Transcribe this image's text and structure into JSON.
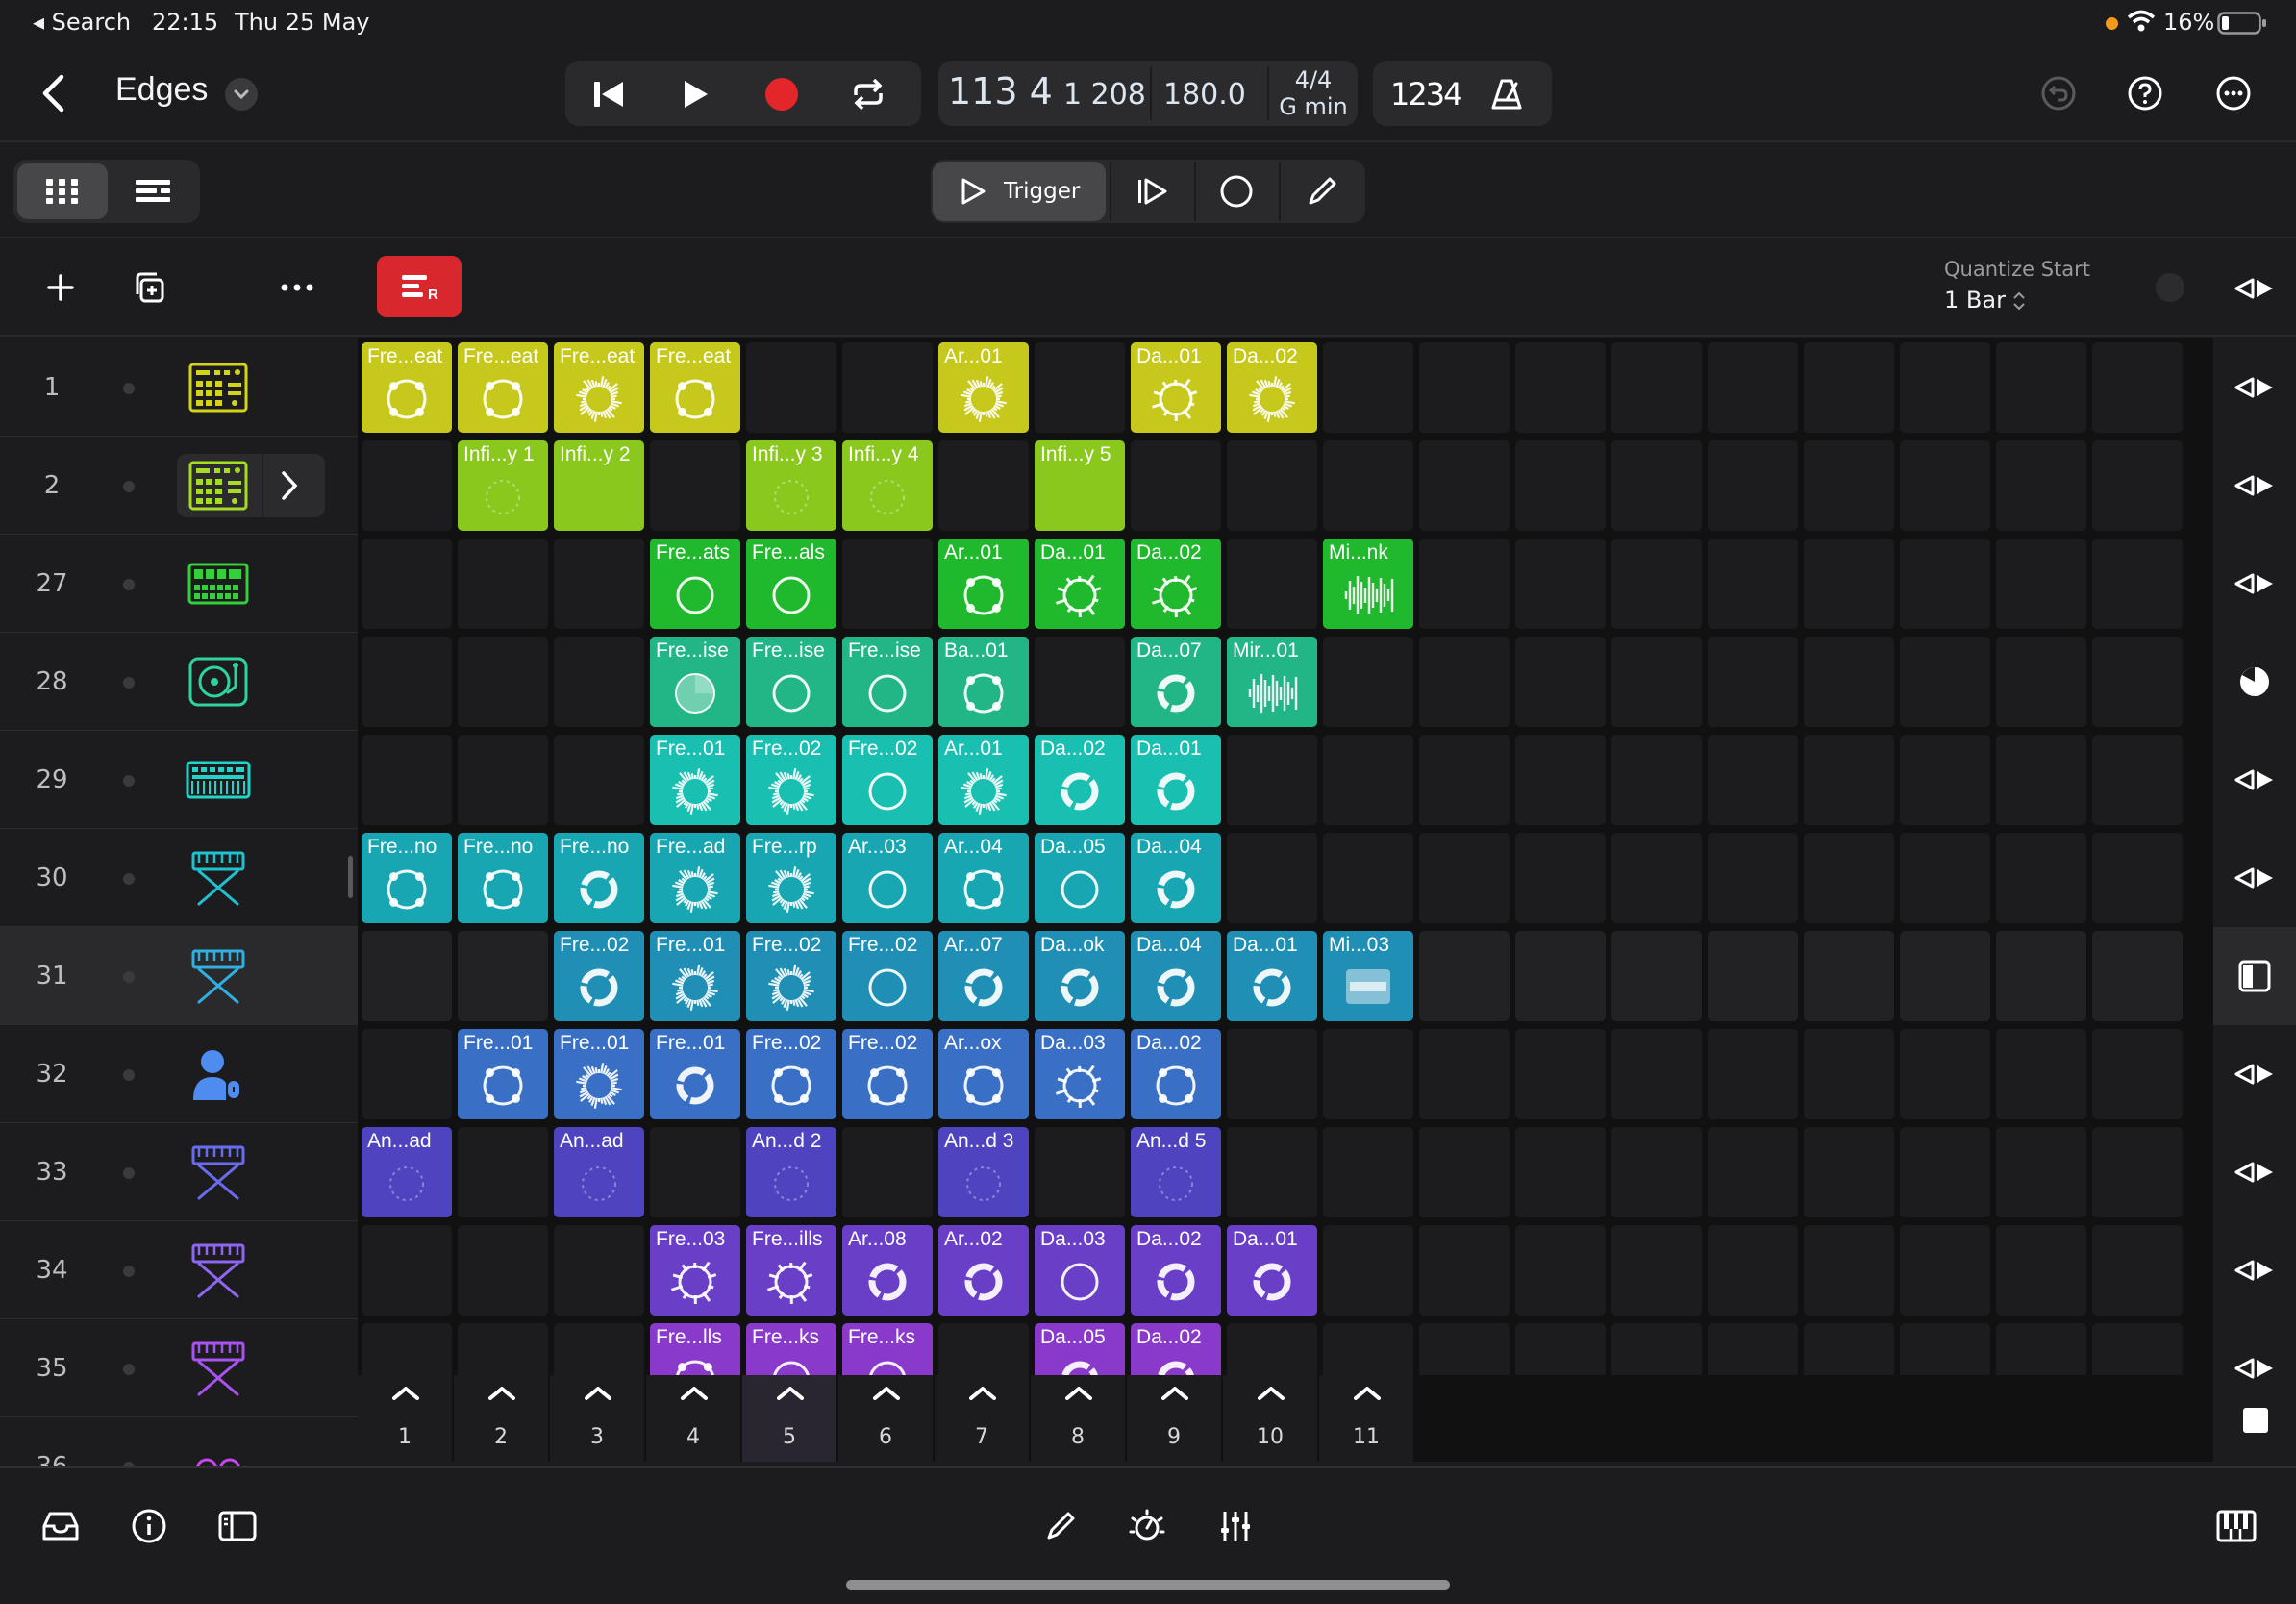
{
  "status_bar": {
    "back_app": "◂ Search",
    "time": "22:15",
    "date": "Thu 25 May",
    "battery": "16%"
  },
  "header": {
    "project_title": "Edges"
  },
  "transport": {
    "bar_beat": "113 4",
    "sub": "1 208",
    "tempo": "180.0",
    "time_signature": "4/4",
    "key": "G min",
    "count_in": "1234"
  },
  "modes": {
    "trigger_label": "Trigger"
  },
  "quantize": {
    "label": "Quantize Start",
    "value": "1 Bar"
  },
  "tracks": [
    {
      "num": "1",
      "icon": "drum-machine-icon",
      "color": "#d3d419"
    },
    {
      "num": "2",
      "icon": "drum-machine-icon",
      "color": "#a6dc24"
    },
    {
      "num": "27",
      "icon": "beat-sequencer-icon",
      "color": "#34d03a"
    },
    {
      "num": "28",
      "icon": "turntable-icon",
      "color": "#2ed3a0"
    },
    {
      "num": "29",
      "icon": "synth-icon",
      "color": "#22d4c8"
    },
    {
      "num": "30",
      "icon": "keyboard-stand-icon",
      "color": "#1fc1cf"
    },
    {
      "num": "31",
      "icon": "keyboard-stand-icon",
      "color": "#2fb0e0"
    },
    {
      "num": "32",
      "icon": "vocalist-icon",
      "color": "#4f8cf0"
    },
    {
      "num": "33",
      "icon": "keyboard-stand-icon",
      "color": "#6a6cf0"
    },
    {
      "num": "34",
      "icon": "keyboard-stand-icon",
      "color": "#8e66f2"
    },
    {
      "num": "35",
      "icon": "keyboard-stand-icon",
      "color": "#a853f0"
    },
    {
      "num": "36",
      "icon": "audio-interface-icon",
      "color": "#c446ee"
    }
  ],
  "clips": [
    [
      {
        "col": 0,
        "label": "Fre...eat",
        "color": "#c6c81c",
        "style": "dots"
      },
      {
        "col": 1,
        "label": "Fre...eat",
        "color": "#c6c81c",
        "style": "dots"
      },
      {
        "col": 2,
        "label": "Fre...eat",
        "color": "#c6c81c",
        "style": "burst"
      },
      {
        "col": 3,
        "label": "Fre...eat",
        "color": "#c6c81c",
        "style": "dots"
      },
      {
        "col": 6,
        "label": "Ar...01",
        "color": "#c6c81c",
        "style": "burst"
      },
      {
        "col": 8,
        "label": "Da...01",
        "color": "#c6c81c",
        "style": "spiky"
      },
      {
        "col": 9,
        "label": "Da...02",
        "color": "#c6c81c",
        "style": "burst"
      }
    ],
    [
      {
        "col": 1,
        "label": "Infi...y 1",
        "color": "#8bc81e",
        "style": "faint"
      },
      {
        "col": 2,
        "label": "Infi...y 2",
        "color": "#8bc81e",
        "style": "none"
      },
      {
        "col": 4,
        "label": "Infi...y 3",
        "color": "#8bc81e",
        "style": "faint"
      },
      {
        "col": 5,
        "label": "Infi...y 4",
        "color": "#8bc81e",
        "style": "faint"
      },
      {
        "col": 7,
        "label": "Infi...y 5",
        "color": "#8bc81e",
        "style": "none"
      }
    ],
    [
      {
        "col": 3,
        "label": "Fre...ats",
        "color": "#20b82c",
        "style": "thin"
      },
      {
        "col": 4,
        "label": "Fre...als",
        "color": "#20b82c",
        "style": "thin"
      },
      {
        "col": 6,
        "label": "Ar...01",
        "color": "#20b82c",
        "style": "dots"
      },
      {
        "col": 7,
        "label": "Da...01",
        "color": "#20b82c",
        "style": "spiky"
      },
      {
        "col": 8,
        "label": "Da...02",
        "color": "#20b82c",
        "style": "spiky"
      },
      {
        "col": 10,
        "label": "Mi...nk",
        "color": "#20b82c",
        "style": "wave"
      }
    ],
    [
      {
        "col": 3,
        "label": "Fre...ise",
        "color": "#22b585",
        "style": "pie"
      },
      {
        "col": 4,
        "label": "Fre...ise",
        "color": "#22b585",
        "style": "thin"
      },
      {
        "col": 5,
        "label": "Fre...ise",
        "color": "#22b585",
        "style": "thin"
      },
      {
        "col": 6,
        "label": "Ba...01",
        "color": "#22b585",
        "style": "dots"
      },
      {
        "col": 8,
        "label": "Da...07",
        "color": "#22b585",
        "style": "thick"
      },
      {
        "col": 9,
        "label": "Mir...01",
        "color": "#22b585",
        "style": "wave"
      }
    ],
    [
      {
        "col": 3,
        "label": "Fre...01",
        "color": "#19bfb0",
        "style": "burst"
      },
      {
        "col": 4,
        "label": "Fre...02",
        "color": "#19bfb0",
        "style": "burst"
      },
      {
        "col": 5,
        "label": "Fre...02",
        "color": "#19bfb0",
        "style": "thin"
      },
      {
        "col": 6,
        "label": "Ar...01",
        "color": "#19bfb0",
        "style": "burst"
      },
      {
        "col": 7,
        "label": "Da...02",
        "color": "#19bfb0",
        "style": "thick"
      },
      {
        "col": 8,
        "label": "Da...01",
        "color": "#19bfb0",
        "style": "thick"
      }
    ],
    [
      {
        "col": 0,
        "label": "Fre...no",
        "color": "#18a6b2",
        "style": "dots"
      },
      {
        "col": 1,
        "label": "Fre...no",
        "color": "#18a6b2",
        "style": "dots"
      },
      {
        "col": 2,
        "label": "Fre...no",
        "color": "#18a6b2",
        "style": "thick"
      },
      {
        "col": 3,
        "label": "Fre...ad",
        "color": "#18a6b2",
        "style": "burst"
      },
      {
        "col": 4,
        "label": "Fre...rp",
        "color": "#18a6b2",
        "style": "burst"
      },
      {
        "col": 5,
        "label": "Ar...03",
        "color": "#18a6b2",
        "style": "thin"
      },
      {
        "col": 6,
        "label": "Ar...04",
        "color": "#18a6b2",
        "style": "dots"
      },
      {
        "col": 7,
        "label": "Da...05",
        "color": "#18a6b2",
        "style": "thin"
      },
      {
        "col": 8,
        "label": "Da...04",
        "color": "#18a6b2",
        "style": "thick"
      }
    ],
    [
      {
        "col": 2,
        "label": "Fre...02",
        "color": "#1f8fb6",
        "style": "thick"
      },
      {
        "col": 3,
        "label": "Fre...01",
        "color": "#1f8fb6",
        "style": "burst"
      },
      {
        "col": 4,
        "label": "Fre...02",
        "color": "#1f8fb6",
        "style": "burst"
      },
      {
        "col": 5,
        "label": "Fre...02",
        "color": "#1f8fb6",
        "style": "thin"
      },
      {
        "col": 6,
        "label": "Ar...07",
        "color": "#1f8fb6",
        "style": "thick"
      },
      {
        "col": 7,
        "label": "Da...ok",
        "color": "#1f8fb6",
        "style": "thick"
      },
      {
        "col": 8,
        "label": "Da...04",
        "color": "#1f8fb6",
        "style": "thick"
      },
      {
        "col": 9,
        "label": "Da...01",
        "color": "#1f8fb6",
        "style": "thick"
      },
      {
        "col": 10,
        "label": "Mi...03",
        "color": "#1f8fb6",
        "style": "block"
      }
    ],
    [
      {
        "col": 1,
        "label": "Fre...01",
        "color": "#3a6fc6",
        "style": "dots"
      },
      {
        "col": 2,
        "label": "Fre...01",
        "color": "#3a6fc6",
        "style": "burst"
      },
      {
        "col": 3,
        "label": "Fre...01",
        "color": "#3a6fc6",
        "style": "thick"
      },
      {
        "col": 4,
        "label": "Fre...02",
        "color": "#3a6fc6",
        "style": "dots"
      },
      {
        "col": 5,
        "label": "Fre...02",
        "color": "#3a6fc6",
        "style": "dots"
      },
      {
        "col": 6,
        "label": "Ar...ox",
        "color": "#3a6fc6",
        "style": "dots"
      },
      {
        "col": 7,
        "label": "Da...03",
        "color": "#3a6fc6",
        "style": "spiky"
      },
      {
        "col": 8,
        "label": "Da...02",
        "color": "#3a6fc6",
        "style": "dots"
      }
    ],
    [
      {
        "col": 0,
        "label": "An...ad",
        "color": "#4e44c0",
        "style": "faint"
      },
      {
        "col": 2,
        "label": "An...ad",
        "color": "#4e44c0",
        "style": "faint"
      },
      {
        "col": 4,
        "label": "An...d 2",
        "color": "#4e44c0",
        "style": "faint"
      },
      {
        "col": 6,
        "label": "An...d 3",
        "color": "#4e44c0",
        "style": "faint"
      },
      {
        "col": 8,
        "label": "An...d 5",
        "color": "#4e44c0",
        "style": "faint"
      }
    ],
    [
      {
        "col": 3,
        "label": "Fre...03",
        "color": "#6a3fc8",
        "style": "spiky"
      },
      {
        "col": 4,
        "label": "Fre...ills",
        "color": "#6a3fc8",
        "style": "spiky"
      },
      {
        "col": 5,
        "label": "Ar...08",
        "color": "#6a3fc8",
        "style": "thick"
      },
      {
        "col": 6,
        "label": "Ar...02",
        "color": "#6a3fc8",
        "style": "thick"
      },
      {
        "col": 7,
        "label": "Da...03",
        "color": "#6a3fc8",
        "style": "thin"
      },
      {
        "col": 8,
        "label": "Da...02",
        "color": "#6a3fc8",
        "style": "thick"
      },
      {
        "col": 9,
        "label": "Da...01",
        "color": "#6a3fc8",
        "style": "thick"
      }
    ],
    [
      {
        "col": 3,
        "label": "Fre...lls",
        "color": "#8a3acb",
        "style": "dots"
      },
      {
        "col": 4,
        "label": "Fre...ks",
        "color": "#8a3acb",
        "style": "thin"
      },
      {
        "col": 5,
        "label": "Fre...ks",
        "color": "#8a3acb",
        "style": "thin"
      },
      {
        "col": 7,
        "label": "Da...05",
        "color": "#8a3acb",
        "style": "thick"
      },
      {
        "col": 8,
        "label": "Da...02",
        "color": "#8a3acb",
        "style": "thick"
      }
    ]
  ],
  "scenes": [
    "1",
    "2",
    "3",
    "4",
    "5",
    "6",
    "7",
    "8",
    "9",
    "10",
    "11"
  ],
  "colors": {
    "record": "#e3262a",
    "live_loops_button": "#d9272e",
    "accent": "#ffffff"
  }
}
